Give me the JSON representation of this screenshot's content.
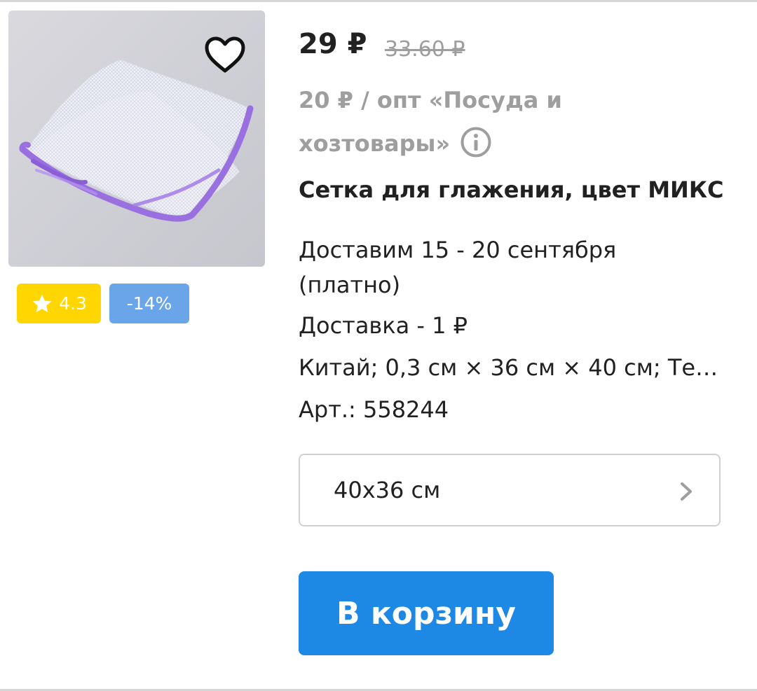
{
  "product": {
    "price": "29 ₽",
    "old_price": "33.60 ₽",
    "wholesale_line1": "20 ₽ / опт «Посуда и",
    "wholesale_line2": "хозтовары»",
    "title": "Сетка для глажения, цвет МИКС",
    "delivery_date": "Доставим 15 - 20 сентября",
    "delivery_paid": "(платно)",
    "delivery_cost": "Доставка - 1 ₽",
    "specs": "Китай; 0,3 см × 36 см × 40 см; Тек...",
    "article": "Арт.: 558244"
  },
  "badges": {
    "rating": "4.3",
    "discount": "-14%"
  },
  "variant": {
    "selected": "40х36 см"
  },
  "actions": {
    "cart_label": "В корзину"
  },
  "icons": {
    "favorite": "heart-outline-icon",
    "info": "info-circle-icon",
    "rating": "star-icon",
    "variant": "chevron-right-icon"
  },
  "colors": {
    "rating_badge": "#ffd600",
    "discount_badge": "#6aa5ea",
    "cart_button": "#1e88e5",
    "muted_text": "#9e9e9e",
    "product_trim": "#9a6fe0"
  }
}
